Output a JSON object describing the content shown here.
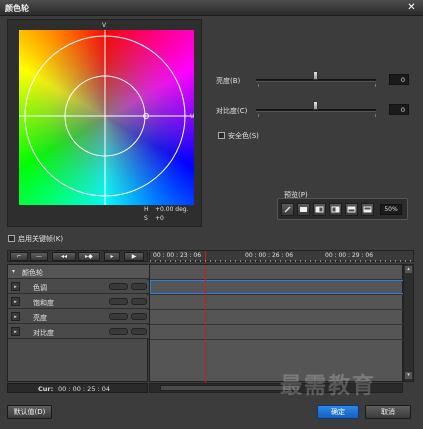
{
  "window": {
    "title": "颜色轮",
    "close_glyph": "✕"
  },
  "wheel": {
    "v_label": "V",
    "u_label": "U",
    "h_label": "H",
    "h_value": "+0.00 deg.",
    "s_label": "S",
    "s_value": "+0"
  },
  "adjust": {
    "brightness_label": "亮度(B)",
    "brightness_value": "0",
    "contrast_label": "对比度(C)",
    "contrast_value": "0",
    "safe_color_label": "安全色(S)"
  },
  "preset": {
    "label": "预览(P)",
    "zoom_value": "50%",
    "icons": [
      "edit-icon",
      "split-a-icon",
      "split-b-icon",
      "split-c-icon",
      "split-d-icon",
      "split-e-icon"
    ]
  },
  "keyframe_toggle": {
    "label": "启用关键帧(K)"
  },
  "timeline": {
    "ruler_labels": [
      "00 : 00 : 23 : 06",
      "00 : 00 : 26 : 06",
      "00 : 00 : 29 : 06"
    ],
    "group_label": "颜色轮",
    "tracks": [
      "色调",
      "饱和度",
      "亮度",
      "对比度"
    ],
    "cur_label": "Cur:",
    "cur_value": "00 : 00 : 25 : 04"
  },
  "buttons": {
    "default": "默认值(D)",
    "ok": "确定",
    "cancel": "取消"
  },
  "watermark": "最需教育",
  "colors": {
    "accent": "#2f7fd8",
    "playhead": "#c81e1e",
    "background": "#3c3c3c"
  }
}
